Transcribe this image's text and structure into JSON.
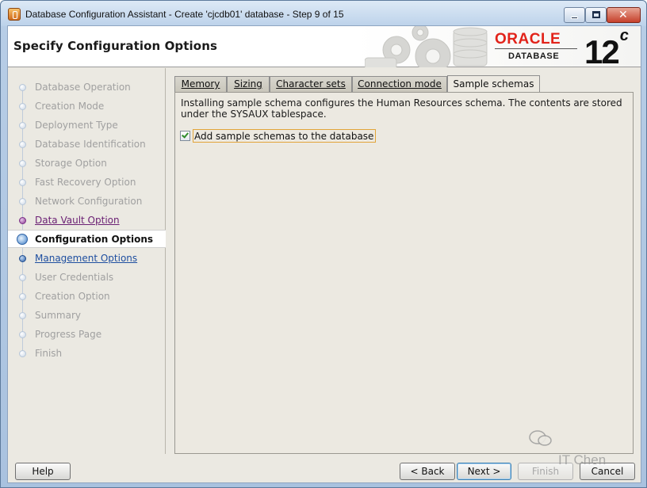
{
  "window": {
    "title": "Database Configuration Assistant - Create 'cjcdb01' database - Step 9 of 15"
  },
  "header": {
    "page_title": "Specify Configuration Options",
    "logo_brand": "ORACLE",
    "logo_product": "DATABASE",
    "logo_version": "12",
    "logo_version_suffix": "c",
    "accent_color": "#e2231a"
  },
  "nav": {
    "items": [
      {
        "label": "Database Operation",
        "state": "done"
      },
      {
        "label": "Creation Mode",
        "state": "done"
      },
      {
        "label": "Deployment Type",
        "state": "done"
      },
      {
        "label": "Database Identification",
        "state": "done"
      },
      {
        "label": "Storage Option",
        "state": "done"
      },
      {
        "label": "Fast Recovery Option",
        "state": "done"
      },
      {
        "label": "Network Configuration",
        "state": "done"
      },
      {
        "label": "Data Vault Option",
        "state": "visited"
      },
      {
        "label": "Configuration Options",
        "state": "active"
      },
      {
        "label": "Management Options",
        "state": "link"
      },
      {
        "label": "User Credentials",
        "state": "disabled"
      },
      {
        "label": "Creation Option",
        "state": "disabled"
      },
      {
        "label": "Summary",
        "state": "disabled"
      },
      {
        "label": "Progress Page",
        "state": "disabled"
      },
      {
        "label": "Finish",
        "state": "disabled"
      }
    ]
  },
  "tabs": {
    "items": [
      {
        "label": "Memory"
      },
      {
        "label": "Sizing"
      },
      {
        "label": "Character sets"
      },
      {
        "label": "Connection mode"
      },
      {
        "label": "Sample schemas"
      }
    ],
    "selected": "Sample schemas"
  },
  "sample_schemas": {
    "description_line1": "Installing sample schema configures the Human Resources schema. The contents are stored",
    "description_line2": "under the SYSAUX tablespace.",
    "checkbox_label": "Add sample schemas to the database",
    "checkbox_checked": true
  },
  "buttons": {
    "help": "Help",
    "back": "< Back",
    "next": "Next >",
    "finish": "Finish",
    "cancel": "Cancel"
  },
  "watermark": {
    "text": "IT  Chen"
  }
}
